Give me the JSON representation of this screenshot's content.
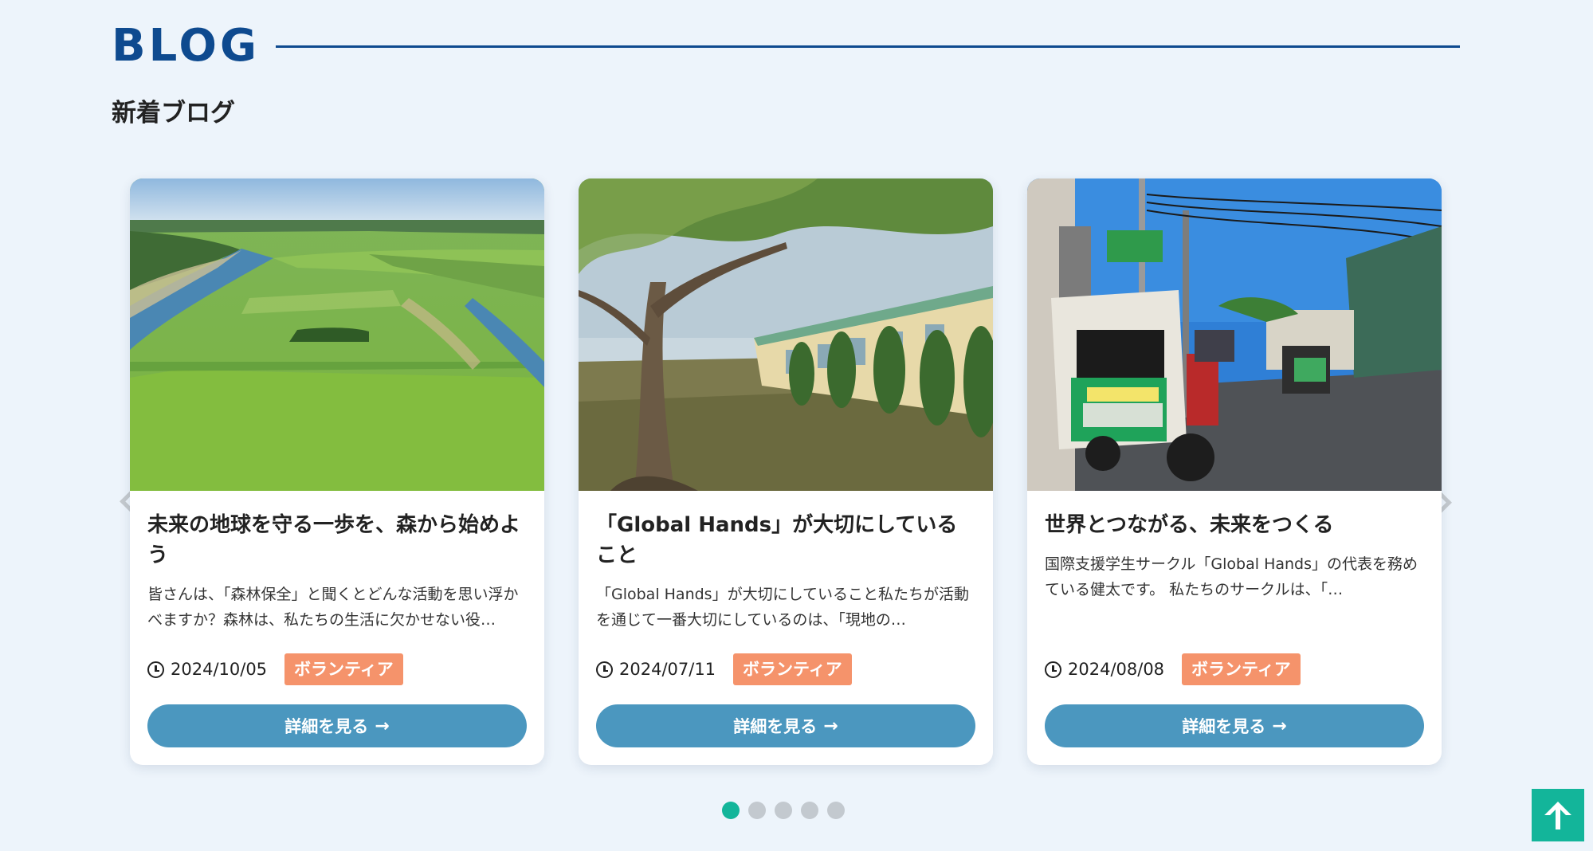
{
  "section": {
    "title": "BLOG",
    "subtitle": "新着ブログ"
  },
  "carousel": {
    "prev_icon": "chevron-left-icon",
    "next_icon": "chevron-right-icon",
    "dots_count": 5,
    "active_dot": 0
  },
  "cards": [
    {
      "title": "未来の地球を守る一歩を、森から始めよう",
      "excerpt": "皆さんは、「森林保全」と聞くとどんな活動を思い浮かべますか？森林は、私たちの生活に欠かせない役…",
      "date": "2024/10/05",
      "tag": "ボランティア",
      "button_label": "詳細を見る",
      "button_icon": "arrow-right-icon"
    },
    {
      "title": "「Global Hands」が大切にしていること",
      "excerpt": "「Global Hands」が大切にしていること私たちが活動を通じて一番大切にしているのは、「現地の…",
      "date": "2024/07/11",
      "tag": "ボランティア",
      "button_label": "詳細を見る",
      "button_icon": "arrow-right-icon"
    },
    {
      "title": "世界とつながる、未来をつくる",
      "excerpt": "国際支援学生サークル「Global Hands」の代表を務めている健太です。 私たちのサークルは、「…",
      "date": "2024/08/08",
      "tag": "ボランティア",
      "button_label": "詳細を見る",
      "button_icon": "arrow-right-icon"
    }
  ],
  "back_to_top_icon": "arrow-up-icon",
  "colors": {
    "heading": "#0e4a8f",
    "tag": "#f5936b",
    "button": "#4b97bf",
    "accent": "#13b59a",
    "background": "#edf4fb"
  }
}
